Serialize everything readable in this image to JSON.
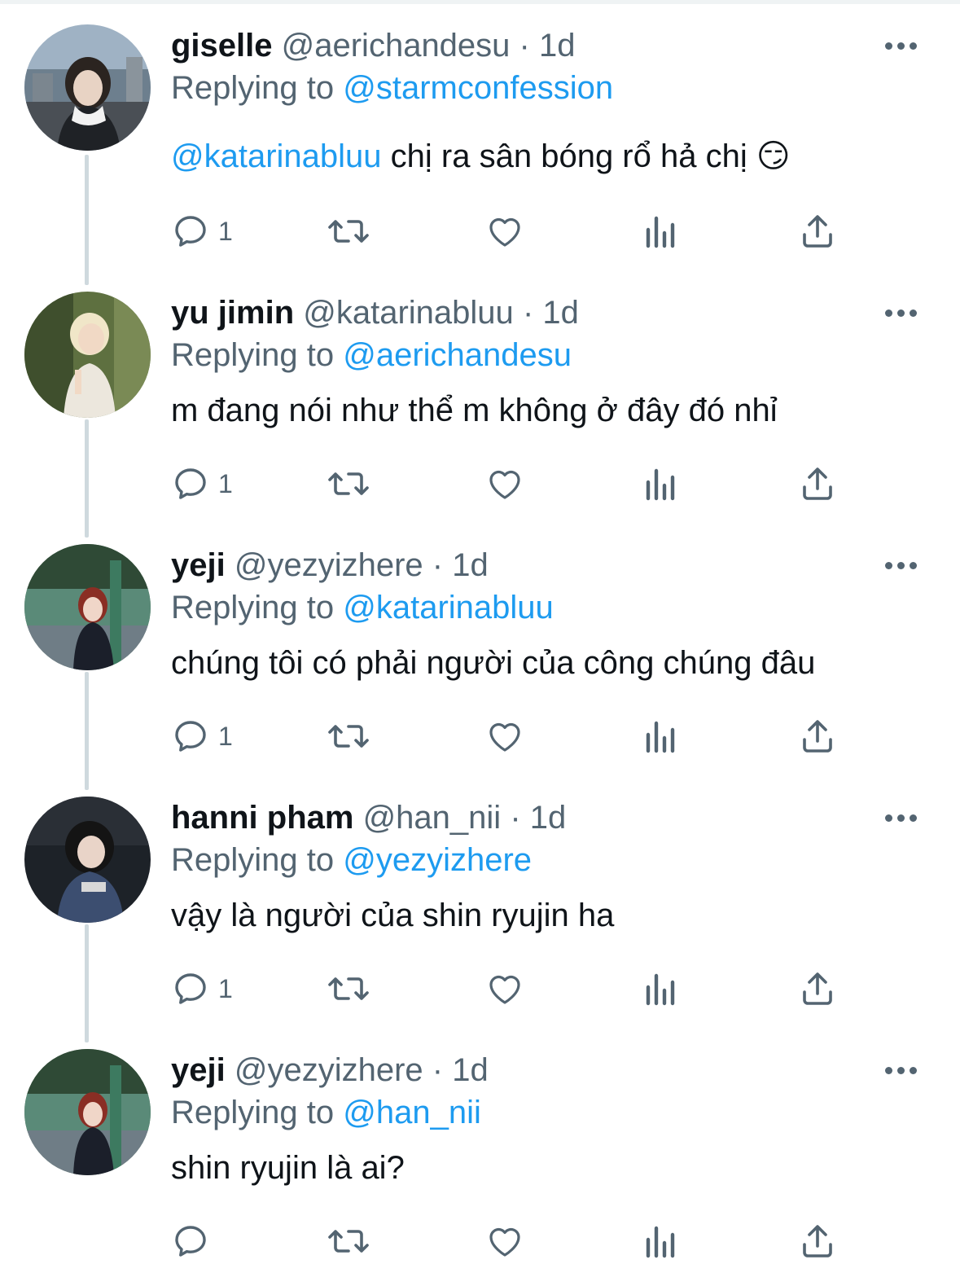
{
  "tweets": [
    {
      "name": "giselle",
      "handle": "@aerichandesu",
      "time": "1d",
      "replying_prefix": "Replying to",
      "replying_to": "@starmconfession",
      "mention": "@katarinabluu",
      "text": "chị ra sân bóng rổ hả chị",
      "emoji": "😏",
      "reply_count": "1"
    },
    {
      "name": "yu jimin",
      "handle": "@katarinabluu",
      "time": "1d",
      "replying_prefix": "Replying to",
      "replying_to": "@aerichandesu",
      "text": "m đang nói như thể m không ở đây đó nhỉ",
      "reply_count": "1"
    },
    {
      "name": "yeji",
      "handle": "@yezyizhere",
      "time": "1d",
      "replying_prefix": "Replying to",
      "replying_to": "@katarinabluu",
      "text": "chúng tôi có phải người của công chúng đâu",
      "reply_count": "1"
    },
    {
      "name": "hanni pham",
      "handle": "@han_nii",
      "time": "1d",
      "replying_prefix": "Replying to",
      "replying_to": "@yezyizhere",
      "text": "vậy là người của shin ryujin ha",
      "reply_count": "1"
    },
    {
      "name": "yeji",
      "handle": "@yezyizhere",
      "time": "1d",
      "replying_prefix": "Replying to",
      "replying_to": "@han_nii",
      "text": "shin ryujin là ai?",
      "reply_count": ""
    }
  ],
  "separator": "·",
  "icons": [
    "reply-icon",
    "retweet-icon",
    "like-icon",
    "views-icon",
    "share-icon",
    "more-icon"
  ],
  "colors": {
    "text": "#0f1419",
    "secondary": "#536471",
    "link": "#1d9bf0",
    "thread": "#cfd9de"
  }
}
